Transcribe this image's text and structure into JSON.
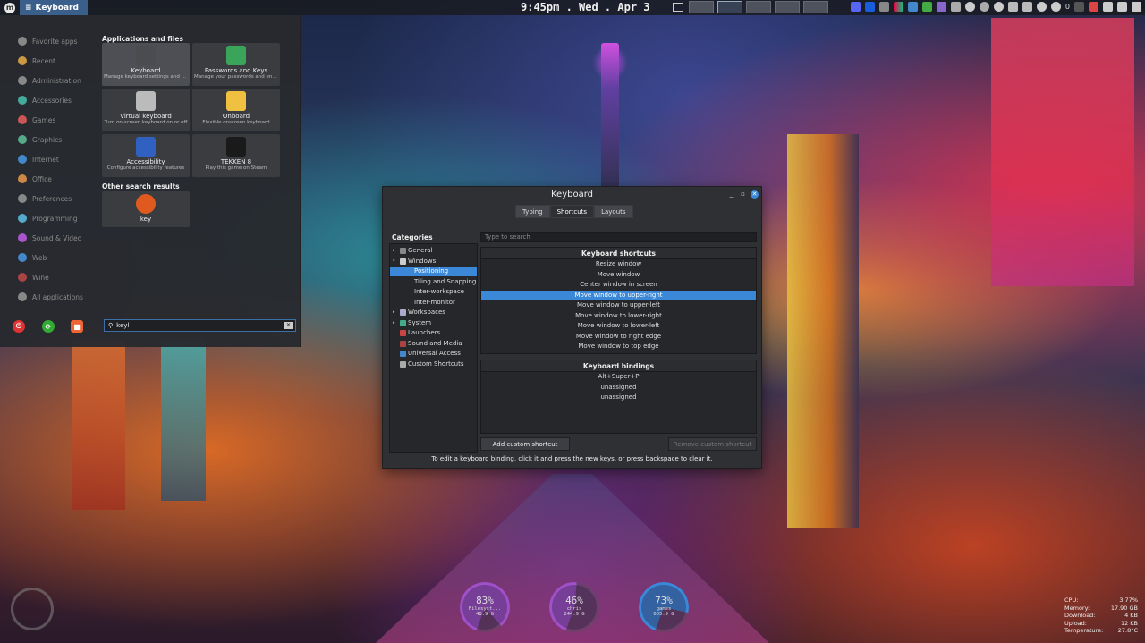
{
  "panel": {
    "active_window": "Keyboard",
    "clock": "9:45pm . Wed . Apr  3",
    "tray_text": "0"
  },
  "menu": {
    "categories": [
      "Favorite apps",
      "Recent",
      "Administration",
      "Accessories",
      "Games",
      "Graphics",
      "Internet",
      "Office",
      "Preferences",
      "Programming",
      "Sound & Video",
      "Web",
      "Wine",
      "All applications"
    ],
    "apps_heading": "Applications and files",
    "apps": [
      {
        "name": "Keyboard",
        "desc": "Manage keyboard settings and s...",
        "color": "#4a4c50"
      },
      {
        "name": "Passwords and Keys",
        "desc": "Manage your passwords and enc...",
        "color": "#3aa55a"
      },
      {
        "name": "Virtual keyboard",
        "desc": "Turn on-screen keyboard on or off",
        "color": "#bbbbbb"
      },
      {
        "name": "Onboard",
        "desc": "Flexible onscreen keyboard",
        "color": "#f0c040"
      },
      {
        "name": "Accessibility",
        "desc": "Configure accessibility features",
        "color": "#3060c0"
      },
      {
        "name": "TEKKEN 8",
        "desc": "Play this game on Steam",
        "color": "#1a1a1a"
      }
    ],
    "other_heading": "Other search results",
    "other": [
      {
        "name": "key",
        "color": "#e05a20"
      }
    ],
    "search_value": "keyl"
  },
  "keyboard": {
    "title": "Keyboard",
    "tabs": [
      "Typing",
      "Shortcuts",
      "Layouts"
    ],
    "categories_label": "Categories",
    "tree": [
      "General",
      "Windows",
      "Positioning",
      "Tiling and Snapping",
      "Inter-workspace",
      "Inter-monitor",
      "Workspaces",
      "System",
      "Launchers",
      "Sound and Media",
      "Universal Access",
      "Custom Shortcuts"
    ],
    "search_placeholder": "Type to search",
    "shortcuts_head": "Keyboard shortcuts",
    "shortcuts": [
      "Resize window",
      "Move window",
      "Center window in screen",
      "Move window to upper-right",
      "Move window to upper-left",
      "Move window to lower-right",
      "Move window to lower-left",
      "Move window to right edge",
      "Move window to top edge"
    ],
    "bindings_head": "Keyboard bindings",
    "bindings": [
      "Alt+Super+P",
      "unassigned",
      "unassigned"
    ],
    "add_button": "Add custom shortcut",
    "remove_button": "Remove custom shortcut",
    "hint": "To edit a keyboard binding, click it and press the new keys, or press backspace to clear it."
  },
  "gauges": [
    {
      "pct": "83%",
      "name": "Filesyst...",
      "size": "48.9 G",
      "color": "#a050c8",
      "value": 0.83
    },
    {
      "pct": "46%",
      "name": "chris",
      "size": "244.9 G",
      "color": "#a050c8",
      "value": 0.46
    },
    {
      "pct": "73%",
      "name": "games",
      "size": "605.9 G",
      "color": "#3b87d8",
      "value": 0.73
    }
  ],
  "sysmon": [
    {
      "k": "CPU:",
      "v": "3.77%"
    },
    {
      "k": "Memory:",
      "v": "17.90 GB"
    },
    {
      "k": "Download:",
      "v": "4 KB"
    },
    {
      "k": "Upload:",
      "v": "12 KB"
    },
    {
      "k": "Temperature:",
      "v": "27.8°C"
    }
  ],
  "colors": {
    "accent": "#3b87d8"
  }
}
